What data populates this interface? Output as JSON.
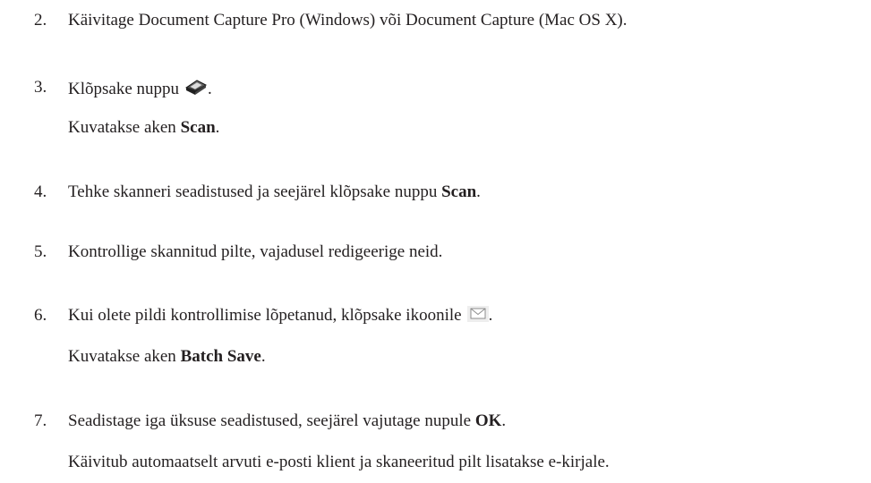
{
  "steps": [
    {
      "num": "2.",
      "text": "Käivitage Document Capture Pro (Windows) või Document Capture (Mac OS X)."
    },
    {
      "num": "3.",
      "text_before": "Klõpsake nuppu",
      "text_after": ".",
      "icon": "scanner-icon",
      "cont_before": "Kuvatakse aken ",
      "cont_bold": "Scan",
      "cont_after": "."
    },
    {
      "num": "4.",
      "text_before": "Tehke skanneri seadistused ja seejärel klõpsake nuppu ",
      "text_bold": "Scan",
      "text_after": "."
    },
    {
      "num": "5.",
      "text": "Kontrollige skannitud pilte, vajadusel redigeerige neid."
    },
    {
      "num": "6.",
      "text_before": "Kui olete pildi kontrollimise lõpetanud, klõpsake ikoonile",
      "text_after": ".",
      "icon": "email-icon",
      "cont_before": "Kuvatakse aken ",
      "cont_bold": "Batch Save",
      "cont_after": "."
    },
    {
      "num": "7.",
      "text_before": "Seadistage iga üksuse seadistused, seejärel vajutage nupule ",
      "text_bold": "OK",
      "text_after": ".",
      "cont": "Käivitub automaatselt arvuti e-posti klient ja skaneeritud pilt lisatakse e-kirjale."
    }
  ]
}
